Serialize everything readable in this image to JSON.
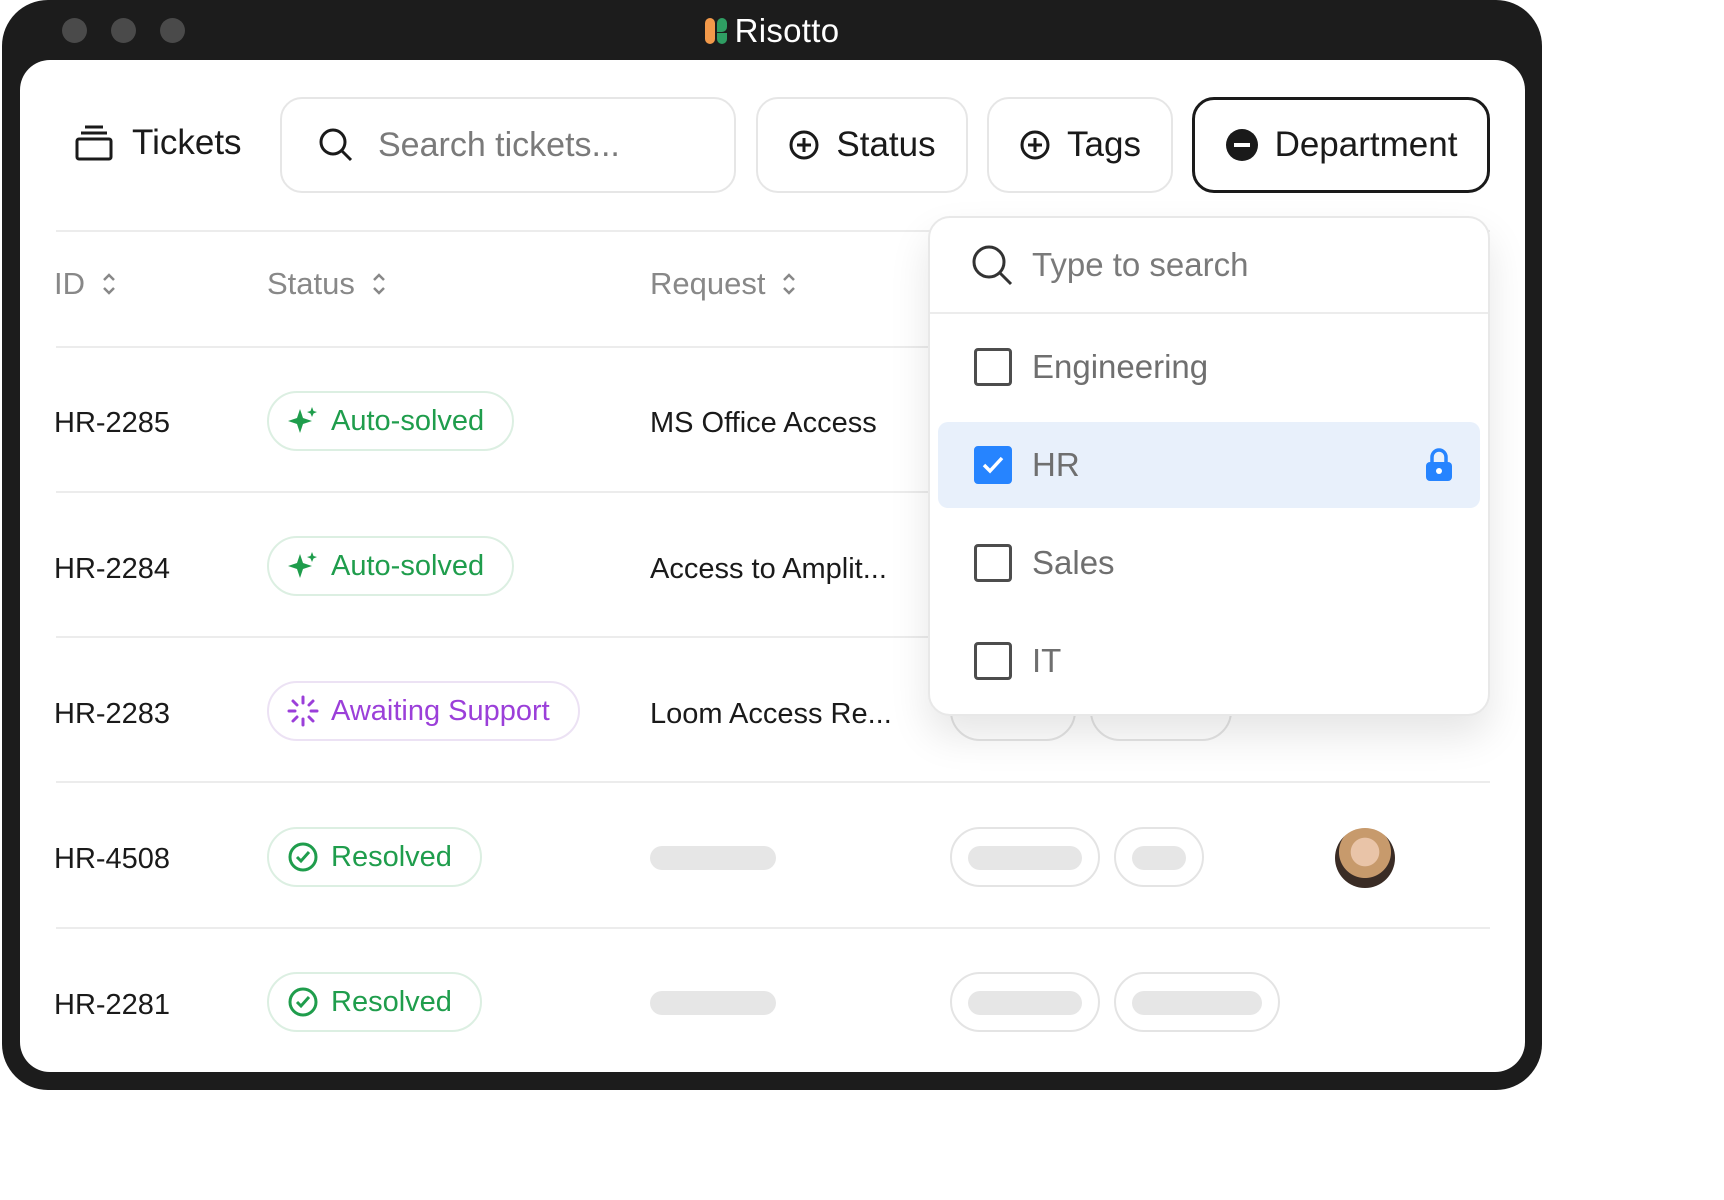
{
  "window": {
    "title": "Risotto"
  },
  "toolbar": {
    "title": "Tickets",
    "search_placeholder": "Search tickets...",
    "filters": {
      "status": "Status",
      "tags": "Tags",
      "department": "Department"
    }
  },
  "table": {
    "columns": {
      "id": "ID",
      "status": "Status",
      "request": "Request"
    },
    "rows": [
      {
        "id": "HR-2285",
        "status": "Auto-solved",
        "request": "MS Office Access"
      },
      {
        "id": "HR-2284",
        "status": "Auto-solved",
        "request": "Access to Amplit..."
      },
      {
        "id": "HR-2283",
        "status": "Awaiting Support",
        "request": "Loom Access Re..."
      },
      {
        "id": "HR-4508",
        "status": "Resolved",
        "request": ""
      },
      {
        "id": "HR-2281",
        "status": "Resolved",
        "request": ""
      }
    ]
  },
  "department_dropdown": {
    "search_placeholder": "Type to search",
    "options": [
      {
        "label": "Engineering",
        "checked": false
      },
      {
        "label": "HR",
        "checked": true,
        "locked": true
      },
      {
        "label": "Sales",
        "checked": false
      },
      {
        "label": "IT",
        "checked": false
      }
    ]
  },
  "colors": {
    "status_green": "#1f9d4c",
    "status_purple": "#9b3fd9",
    "checkbox_blue": "#2684ff",
    "selected_row": "#e8f0fb"
  }
}
